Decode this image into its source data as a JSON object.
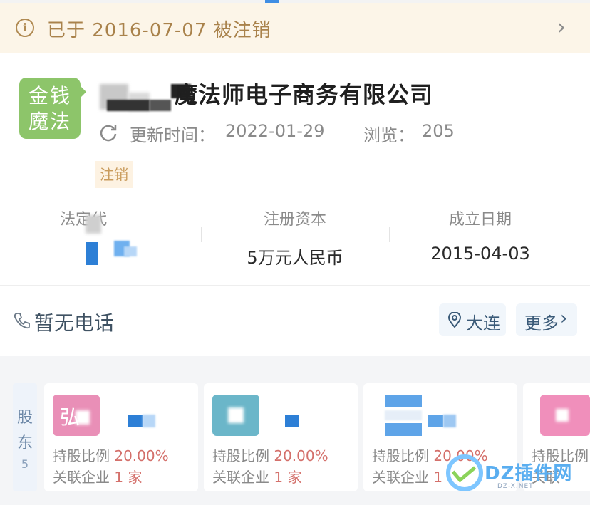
{
  "banner": {
    "icon": "info-icon",
    "text": "已于 2016-07-07 被注销",
    "chevron": "›"
  },
  "company": {
    "logo_line1": "金钱",
    "logo_line2": "魔法",
    "name": "魔法师电子商务有限公司",
    "update_label": "更新时间：",
    "update_value": "2022-01-29",
    "views_label": "浏览：",
    "views_value": "205",
    "status_tag": "注销"
  },
  "stats": {
    "legal_label": "法定代",
    "capital_label": "注册资本",
    "capital_value": "5万元人民币",
    "founded_label": "成立日期",
    "founded_value": "2015-04-03"
  },
  "contact": {
    "phone_text": "暂无电话",
    "location_text": "大连",
    "more_text": "更多",
    "more_chevron": "›"
  },
  "shareholders": {
    "label_c1": "股",
    "label_c2": "东",
    "count": "5",
    "ratio_label": "持股比例",
    "related_label": "关联企业",
    "cards": [
      {
        "avatar_char": "弘",
        "avatar_color": "#e98fb7",
        "ratio": "20.00%",
        "related": "1 家"
      },
      {
        "avatar_char": "",
        "avatar_color": "#6bb6c9",
        "ratio": "20.00%",
        "related": "1 家"
      },
      {
        "avatar_char": "",
        "avatar_color": "#5ea4e8",
        "ratio": "20.00%",
        "related": "1"
      },
      {
        "avatar_char": "",
        "avatar_color": "#f08fbb",
        "ratio": "",
        "related": ""
      }
    ],
    "card4_ratio": "持股比例",
    "card4_related": "关联"
  },
  "watermark": {
    "text": "DZ插件网",
    "sub": "DZ-X.NET"
  },
  "colors": {
    "banner_bg": "#fcf5e8",
    "banner_text": "#a9824b",
    "logo_green": "#8dc56a",
    "accent_red": "#d4706b",
    "link_blue": "#3a5a78"
  }
}
